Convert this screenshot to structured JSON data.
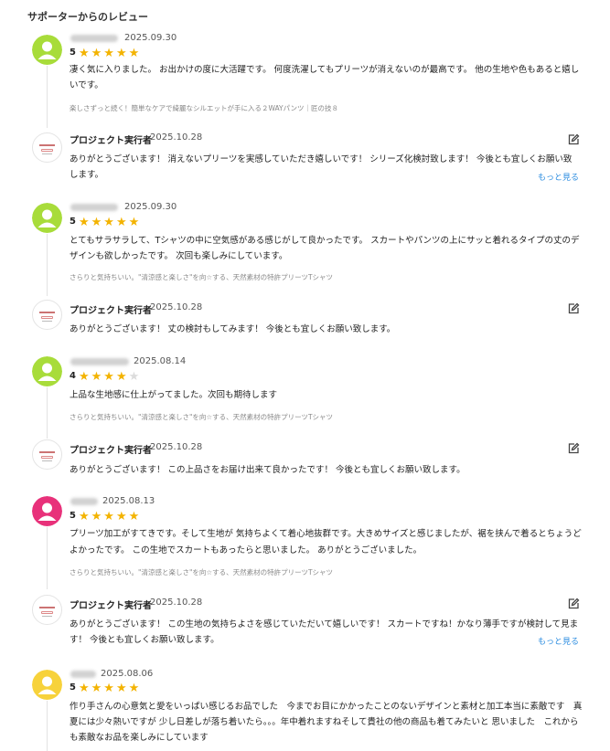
{
  "heading": "サポーターからのレビュー",
  "stars_max": 5,
  "reviews": [
    {
      "avatar_color": "#a8dc3a",
      "date": "2025.09.30",
      "rating": 5,
      "text_lines": [
        "凄く気に入りました。 お出かけの度に大活躍です。 何度洗濯してもプリーツが消えないのが最高です。 他の生地や色もあると嬉し",
        "いです。"
      ],
      "product": "楽しさずっと続く！簡単なケアで綺麗なシルエットが手に入る２WAYパンツ｜匠の技８",
      "reply": {
        "name": "プロジェクト実行者",
        "date": "2025.10.28",
        "text": "ありがとうございます！ 消えないプリーツを実感していただき嬉しいです！ シリーズ化検討致します！ 今後とも宜しくお願い致",
        "text2": "します。",
        "more": "もっと見る"
      }
    },
    {
      "avatar_color": "#a8dc3a",
      "date": "2025.09.30",
      "rating": 5,
      "text_lines": [
        "とてもサラサラして、Tシャツの中に空気感がある感じがして良かったです。 スカートやパンツの上にサッと着れるタイプの丈のデ",
        "ザインも欲しかったです。 次回も楽しみにしています。"
      ],
      "product": "さらりと気持ちいい。\"清涼感と楽しさ\"を向☆する、天然素材の特許プリーツTシャツ",
      "reply": {
        "name": "プロジェクト実行者",
        "date": "2025.10.28",
        "text": "ありがとうございます！ 丈の検討もしてみます！ 今後とも宜しくお願い致します。"
      }
    },
    {
      "avatar_color": "#a8dc3a",
      "date": "2025.08.14",
      "rating": 4,
      "text_lines": [
        "上品な生地感に仕上がってました。次回も期待します"
      ],
      "product": "さらりと気持ちいい。\"清涼感と楽しさ\"を向☆する、天然素材の特許プリーツTシャツ",
      "reply": {
        "name": "プロジェクト実行者",
        "date": "2025.10.28",
        "text": "ありがとうございます！ この上品さをお届け出来て良かったです！ 今後とも宜しくお願い致します。"
      }
    },
    {
      "avatar_color": "#e8317a",
      "date": "2025.08.13",
      "rating": 5,
      "text_lines": [
        "プリーツ加工がすてきです。そして生地が 気持ちよくて着心地抜群です。大きめサイズと感じましたが、裾を挟んで着るとちょうど",
        "よかったです。 この生地でスカートもあったらと思いました。 ありがとうございました。"
      ],
      "product": "さらりと気持ちいい。\"清涼感と楽しさ\"を向☆する、天然素材の特許プリーツTシャツ",
      "reply": {
        "name": "プロジェクト実行者",
        "date": "2025.10.28",
        "text": "ありがとうございます！ この生地の気持ちよさを感じていただいて嬉しいです！ スカートですね！かなり薄手ですが検討して見ま",
        "text2": "す！ 今後とも宜しくお願い致します。",
        "more": "もっと見る"
      }
    },
    {
      "avatar_color": "#f7d23b",
      "date": "2025.08.06",
      "rating": 5,
      "text_lines": [
        "作り手さんの心意気と愛をいっぱい感じるお品でした　今までお目にかかったことのないデザインと素材と加工本当に素敵です　真",
        "夏には少々熱いですが 少し日差しが落ち着いたら。。。年中着れますねそして貴社の他の商品も着てみたいと 思いました　これから",
        "も素敵なお品を楽しみにしています"
      ]
    }
  ]
}
